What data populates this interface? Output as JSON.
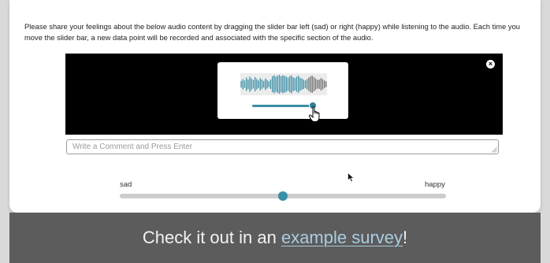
{
  "instructions": "Please share your feelings about the below audio content by dragging the slider bar left (sad) or right (happy) while listening to the audio. Each time you move the slider bar, a new data point will be recorded and associated with the specific section of the audio.",
  "player": {
    "close_icon": "close-icon",
    "close_glyph": "×",
    "progress": 0.96,
    "colors": {
      "background": "#000000",
      "played": "#3a8ea6",
      "unplayed": "#6f6f6f"
    },
    "waveform": [
      0.35,
      0.55,
      0.4,
      0.7,
      0.5,
      0.8,
      0.6,
      0.45,
      0.75,
      0.55,
      0.4,
      0.65,
      0.5,
      0.35,
      0.6,
      0.45,
      0.3,
      0.5,
      0.85,
      0.95,
      0.8,
      0.9,
      1.0,
      0.85,
      0.95,
      0.9,
      0.8,
      0.7,
      0.85,
      0.95,
      0.75,
      0.65,
      0.8,
      0.9,
      0.7,
      0.6,
      0.5,
      0.4,
      0.55,
      0.7,
      0.85,
      0.9,
      0.75,
      0.6,
      0.45,
      0.5,
      0.65,
      0.55,
      0.4,
      0.3
    ]
  },
  "comment": {
    "placeholder": "Write a Comment and Press Enter",
    "value": ""
  },
  "feeling_slider": {
    "left_label": "sad",
    "right_label": "happy",
    "value": 0.5,
    "color": "#3a8ea6"
  },
  "banner": {
    "prefix": "Check it out in an ",
    "link": "example survey",
    "suffix": "!"
  }
}
